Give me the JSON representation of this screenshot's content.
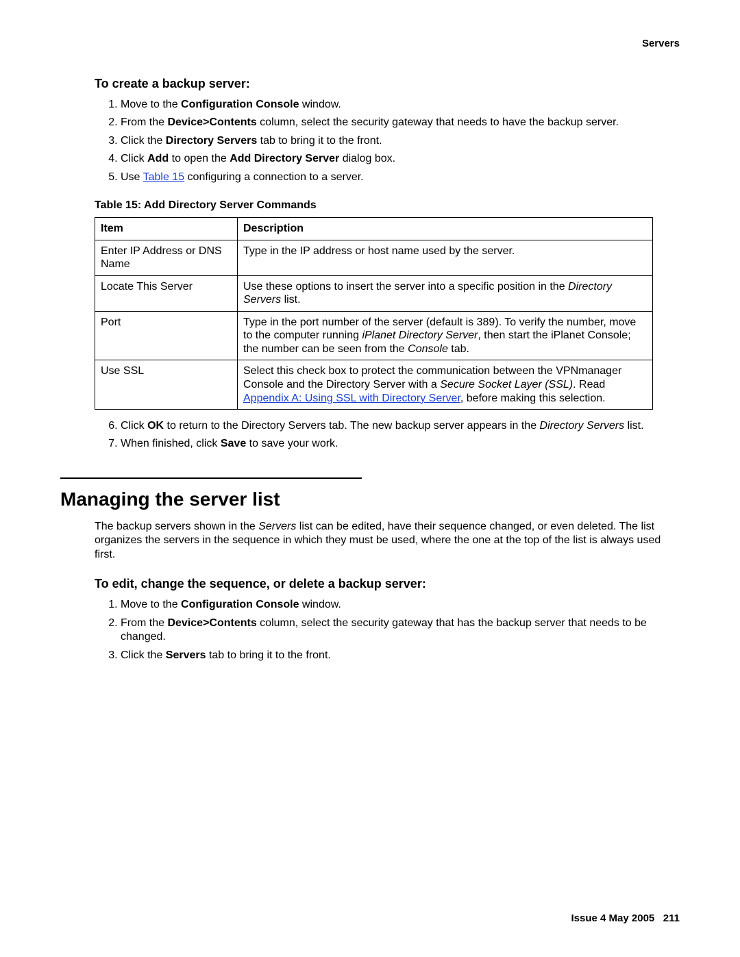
{
  "header": {
    "right": "Servers"
  },
  "section1": {
    "title": "To create a backup server:",
    "steps": {
      "s1": {
        "pre": "Move to the ",
        "bold": "Configuration Console",
        "post": " window."
      },
      "s2": {
        "pre": "From the ",
        "bold": "Device>Contents",
        "post": " column, select the security gateway that needs to have the backup server."
      },
      "s3": {
        "pre": "Click the ",
        "bold": "Directory Servers",
        "post": " tab to bring it to the front."
      },
      "s4": {
        "pre": "Click ",
        "bold1": "Add",
        "mid": " to open the ",
        "bold2": "Add Directory Server",
        "post": " dialog box."
      },
      "s5": {
        "pre": "Use ",
        "link": "Table 15",
        "post": " configuring a connection to a server."
      }
    },
    "table": {
      "caption": "Table 15: Add Directory Server Commands",
      "head": {
        "c1": "Item",
        "c2": "Description"
      },
      "rows": {
        "r1": {
          "item": "Enter IP Address or DNS Name",
          "desc": "Type in the IP address or host name used by the server."
        },
        "r2": {
          "item": "Locate This Server",
          "desc_pre": "Use these options to insert the server into a specific position in the ",
          "desc_it": "Directory Servers",
          "desc_post": " list."
        },
        "r3": {
          "item": "Port",
          "desc_pre": "Type in the port number of the server (default is 389). To verify the number, move to the computer running ",
          "desc_it1": "iPlanet Directory Server",
          "desc_mid": ", then start the iPlanet Console; the number can be seen from the ",
          "desc_it2": "Console",
          "desc_post": " tab."
        },
        "r4": {
          "item": "Use SSL",
          "desc_pre": "Select this check box to protect the communication between the VPNmanager Console and the Directory Server with a ",
          "desc_it": "Secure Socket Layer (SSL)",
          "desc_mid": ". Read ",
          "desc_link": "Appendix A: Using SSL with Directory Server",
          "desc_post": ", before making this selection."
        }
      }
    },
    "steps2": {
      "s6": {
        "pre": "Click ",
        "bold": "OK",
        "mid": " to return to the Directory Servers tab. The new backup server appears in the ",
        "it": "Directory Servers",
        "post": " list."
      },
      "s7": {
        "pre": "When finished, click ",
        "bold": "Save",
        "post": " to save your work."
      }
    }
  },
  "section2": {
    "heading": "Managing the server list",
    "para_pre": "The backup servers shown in the ",
    "para_it": "Servers",
    "para_post": " list can be edited, have their sequence changed, or even deleted. The list organizes the servers in the sequence in which they must be used, where the one at the top of the list is always used first.",
    "subtitle": "To edit, change the sequence, or delete a backup server:",
    "steps": {
      "s1": {
        "pre": "Move to the ",
        "bold": "Configuration Console",
        "post": " window."
      },
      "s2": {
        "pre": "From the ",
        "bold": "Device>Contents",
        "post": " column, select the security gateway that has the backup server that needs to be changed."
      },
      "s3": {
        "pre": "Click the ",
        "bold": "Servers",
        "post": " tab to bring it to the front."
      }
    }
  },
  "footer": {
    "issue": "Issue 4 May 2005",
    "page": "211"
  }
}
